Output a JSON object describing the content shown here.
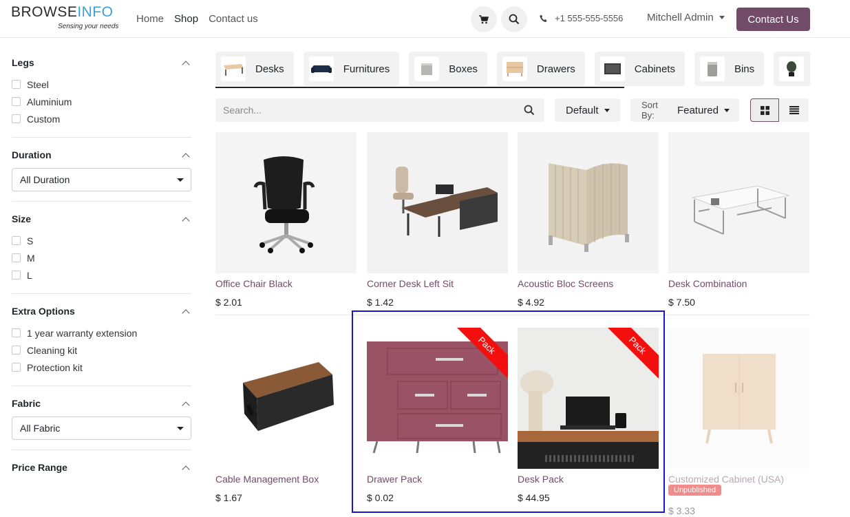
{
  "header": {
    "logo_brand_a": "BROWSE",
    "logo_brand_b": "INFO",
    "logo_tagline": "Sensing your needs",
    "nav": [
      "Home",
      "Shop",
      "Contact us"
    ],
    "phone": "+1 555-555-5556",
    "user": "Mitchell Admin",
    "contact_button": "Contact Us"
  },
  "sidebar": {
    "legs": {
      "title": "Legs",
      "options": [
        "Steel",
        "Aluminium",
        "Custom"
      ]
    },
    "duration": {
      "title": "Duration",
      "selected": "All Duration"
    },
    "size": {
      "title": "Size",
      "options": [
        "S",
        "M",
        "L"
      ]
    },
    "extra": {
      "title": "Extra Options",
      "options": [
        "1 year warranty extension",
        "Cleaning kit",
        "Protection kit"
      ]
    },
    "fabric": {
      "title": "Fabric",
      "selected": "All Fabric"
    },
    "price": {
      "title": "Price Range"
    }
  },
  "categories": [
    "Desks",
    "Furnitures",
    "Boxes",
    "Drawers",
    "Cabinets",
    "Bins"
  ],
  "toolbar": {
    "search_placeholder": "Search...",
    "pricelist": "Default",
    "sort_prefix": "Sort By:",
    "sort_value": "Featured"
  },
  "products": [
    {
      "name": "Office Chair Black",
      "price": "$ 2.01"
    },
    {
      "name": "Corner Desk Left Sit",
      "price": "$ 1.42"
    },
    {
      "name": "Acoustic Bloc Screens",
      "price": "$ 4.92"
    },
    {
      "name": "Desk Combination",
      "price": "$ 7.50"
    },
    {
      "name": "Cable Management Box",
      "price": "$ 1.67"
    },
    {
      "name": "Drawer Pack",
      "price": "$ 0.02",
      "ribbon": "Pack"
    },
    {
      "name": "Desk Pack",
      "price": "$ 44.95",
      "ribbon": "Pack"
    },
    {
      "name": "Customized Cabinet (USA)",
      "price": "$ 3.33",
      "badge": "Unpublished"
    }
  ],
  "colors": {
    "brand": "#714b67",
    "ribbon": "#f40f0f",
    "highlight": "#1414d2"
  }
}
